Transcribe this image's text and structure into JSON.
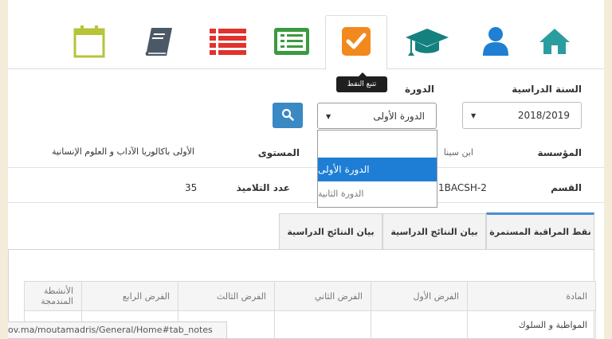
{
  "nav": {
    "tooltip": "تتبع النقط"
  },
  "colors": {
    "home": "#2a9d9f",
    "user": "#1f7fd2",
    "graduation": "#14817f",
    "checkbox": "#f2891e",
    "list_green": "#3b9a3f",
    "list_red": "#e0322e",
    "book": "#4b5866",
    "calendar": "#b6c437",
    "search_button": "#3a88c4",
    "selected_option": "#1e7ed6",
    "active_tab_border": "#4a8fd3"
  },
  "filters": {
    "year_label": "السنة الدراسية",
    "year_value": "2018/2019",
    "session_label": "الدورة",
    "session_value": "الدورة الأولى",
    "session_options": [
      "",
      "الدورة الأولى",
      "الدورة الثانية"
    ]
  },
  "info": {
    "institution_label": "المؤسسة",
    "institution_value": "ابن سينا",
    "level_label": "المستوى",
    "level_value": "الأولى باكالوريا الآداب و العلوم الإنسانية",
    "class_label": "القسم",
    "class_value": "1BACSH-2",
    "students_label": "عدد التلاميذ",
    "students_value": "35"
  },
  "tabs": [
    "نقط المراقبة المستمرة",
    "بيان النتائج الدراسية",
    "بيان النتائج الدراسية"
  ],
  "table": {
    "headers": [
      "المادة",
      "الفرض الأول",
      "الفرض الثاني",
      "الفرض الثالث",
      "الفرض الرابع",
      "الأنشطة المندمجة"
    ],
    "rows": [
      [
        "المواظبة و السلوك",
        "",
        "",
        "",
        "",
        ""
      ]
    ]
  },
  "status_bar": {
    "url": "ov.ma/moutamadris/General/Home#tab_notes"
  }
}
